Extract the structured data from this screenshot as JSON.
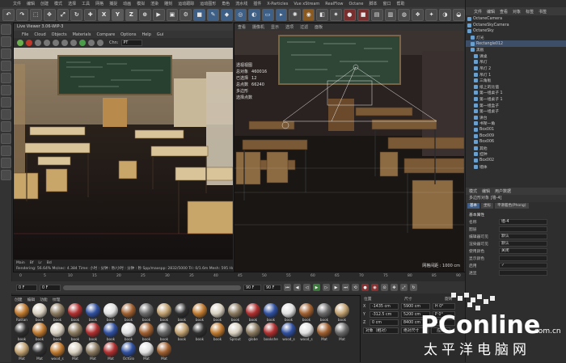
{
  "menubar": [
    "文件",
    "编辑",
    "创建",
    "模式",
    "选择",
    "工具",
    "网格",
    "捕捉",
    "动画",
    "模拟",
    "渲染",
    "雕刻",
    "运动跟踪",
    "运动图形",
    "角色",
    "流水线",
    "插件",
    "X-Particles",
    "Vue xStream",
    "RealFlow",
    "Octane",
    "脚本",
    "窗口",
    "帮助"
  ],
  "toolbar": {
    "letters": [
      "X",
      "Y",
      "Z"
    ]
  },
  "live_viewer": {
    "title": "Live Viewer 3.06-WIP-3",
    "menu": [
      "File",
      "Cloud",
      "Objects",
      "Materials",
      "Compare",
      "Options",
      "Help",
      "Gui"
    ],
    "chn_label": "Chn:",
    "chn_value": "PT",
    "status_line1": "Main  Bf  Lr  Bd",
    "status_line2": "Rendering: 56.64% Ms/sec: 4.384   Time: 小时 : 分钟 : 秒/小时 : 分钟 : 秒  Spp/maxspp: 2832/5000  Tri: 0/1.6m  Mesh: 595 Hu",
    "bottom_tabs": [
      "Main",
      "Bf",
      "Lr",
      "Bd"
    ]
  },
  "viewport": {
    "tabs": [
      "查看",
      "摄像机",
      "显示",
      "选项",
      "过滤",
      "面板"
    ],
    "label": "透视视图",
    "info": [
      "总对象",
      "已选择",
      "总点数",
      "多边形",
      "选择点数"
    ],
    "info_vals": [
      "460016",
      "12",
      "66240",
      "",
      ""
    ],
    "grid_text": "网格间距 : 1000 cm"
  },
  "timeline": {
    "ticks": [
      "0",
      "5",
      "10",
      "15",
      "20",
      "25",
      "30",
      "35",
      "40",
      "45",
      "50",
      "55",
      "60",
      "65",
      "70",
      "75",
      "80",
      "85",
      "90"
    ]
  },
  "transport": {
    "start": "0 F",
    "current": "0 F",
    "end": "90 F",
    "end2": "90 F"
  },
  "right_panel": {
    "tabs": [
      "文件",
      "编辑",
      "查看",
      "对象",
      "标签",
      "书签"
    ],
    "objects": [
      "OctaneCamera",
      "OctaneSkyCamera",
      "OctaneSky",
      "灯光",
      "Rectangle012",
      "黑板",
      "课桌",
      "吊灯",
      "吊灯 2",
      "吊灯 1",
      "三角板",
      "纸上的比值",
      "第一组桌子 1",
      "第一组桌子 1",
      "第一组盒子",
      "第一组桌子",
      "讲台",
      "书架一角",
      "Box001",
      "Box009",
      "Box006",
      "其他",
      "挂钟",
      "Box002",
      "墙体"
    ],
    "selected_index": 4,
    "attr_tabs": [
      "模式",
      "编辑",
      "用户数据"
    ],
    "attr_name": "多边形对象 [墙-4]",
    "attr_sub": [
      "基本",
      "坐标",
      "平滑着色(Phong)"
    ],
    "attr_section": "基本属性",
    "attrs": [
      {
        "label": "名称",
        "value": "墙-4"
      },
      {
        "label": "图层",
        "value": ""
      },
      {
        "label": "编辑器可见",
        "value": "默认"
      },
      {
        "label": "渲染器可见",
        "value": "默认"
      },
      {
        "label": "使用颜色",
        "value": "关闭"
      },
      {
        "label": "显示颜色",
        "value": ""
      },
      {
        "label": "启用",
        "value": "✓"
      },
      {
        "label": "透显",
        "value": ""
      }
    ]
  },
  "material_manager": {
    "menu": [
      "创建",
      "编辑",
      "功能",
      "纹理"
    ],
    "materials": [
      "Rattan",
      "book",
      "book",
      "book",
      "book",
      "book",
      "book",
      "book",
      "book",
      "book",
      "book",
      "book",
      "book",
      "book",
      "book",
      "book",
      "book",
      "book",
      "book",
      "book",
      "book",
      "book",
      "book",
      "book",
      "book",
      "book",
      "book",
      "book",
      "book",
      "book",
      "book",
      "Sprout",
      "globe",
      "bookshe",
      "wood_s",
      "wood_s",
      "Mat",
      "Mat",
      "Mat",
      "Mat",
      "wood_s",
      "Mat",
      "Mat",
      "Mat",
      "OctGlo",
      "Mat",
      "Mat"
    ]
  },
  "coordinates": {
    "headers": [
      "位置",
      "尺寸",
      "旋转"
    ],
    "rows": [
      {
        "axis": "X",
        "pos": "-1435 cm",
        "size": "5900 cm",
        "rot": "H 0°"
      },
      {
        "axis": "Y",
        "pos": "-312.5 cm",
        "size": "5200 cm",
        "rot": "P 0°"
      },
      {
        "axis": "Z",
        "pos": "0 cm",
        "size": "8400 cm",
        "rot": "B 0°"
      }
    ],
    "mode": "对象（相对）",
    "size_mode": "绝对尺寸",
    "apply": "应用"
  },
  "watermark": {
    "brand": "PConline",
    "suffix": ".com.cn",
    "cn": "太平洋电脑网"
  }
}
